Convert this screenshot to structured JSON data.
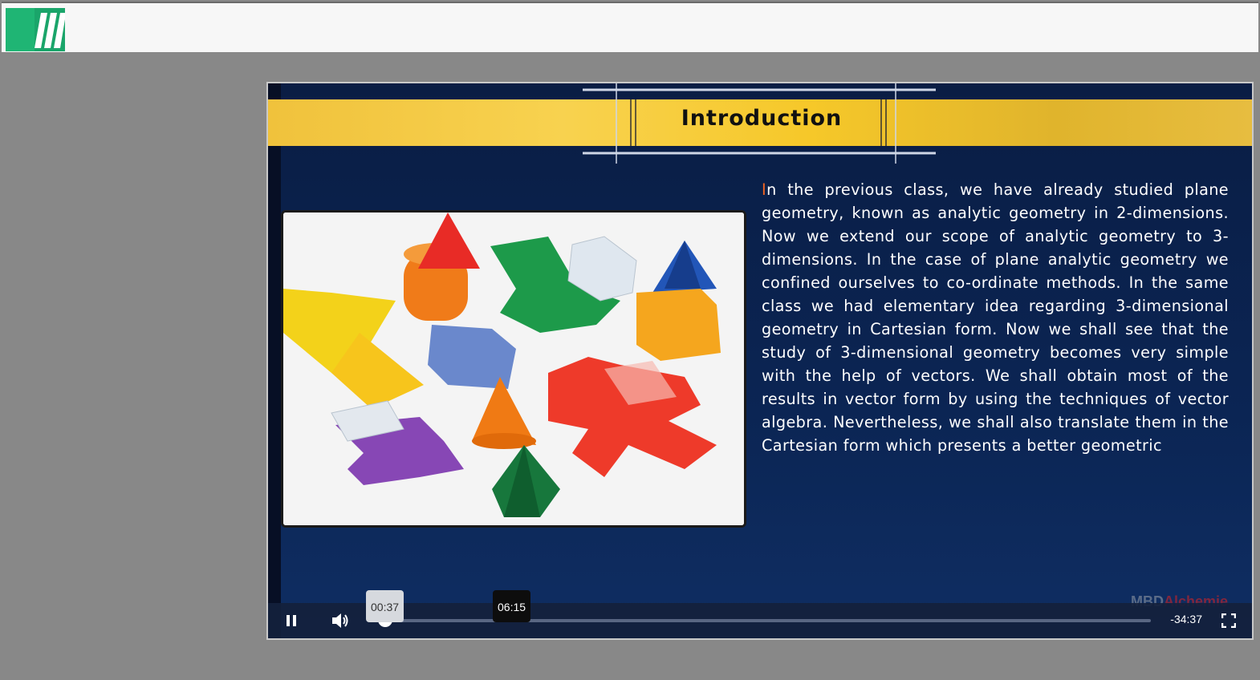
{
  "header": {
    "logo_icon": "brand-logo-icon"
  },
  "slide": {
    "title": "Introduction",
    "dropcap": "I",
    "body": "n the previous class, we have already studied plane geometry, known as analytic geometry in 2-dimensions. Now we extend our scope of analytic geometry to 3-dimensions. In the case of plane analytic geometry we confined ourselves to co-ordinate methods. In the same class we had elementary idea regarding 3-dimensional geometry in Cartesian form. Now we shall see that the study of 3-dimensional geometry becomes very simple with the help of vectors. We shall obtain most of the results in vector form by using the techniques of vector algebra. Nevertheless, we shall also translate them in the Cartesian form which presents a better geometric",
    "watermark_part1": "MBD",
    "watermark_part2": "Alchemie",
    "photo_icon": "geometric-solids-photo"
  },
  "player": {
    "current_time_tooltip": "00:37",
    "hover_time_tooltip": "06:15",
    "remaining_time": "-34:37",
    "progress_fraction": 0.017,
    "buffered_fraction": 0.04,
    "hover_fraction": 0.178,
    "state": "playing",
    "icons": {
      "pause": "pause-icon",
      "volume": "volume-icon",
      "fullscreen": "fullscreen-icon"
    }
  },
  "colors": {
    "page_background": "#888888",
    "slide_background": "#0b1f44",
    "banner": "#f6c829",
    "dropcap": "#f26522"
  }
}
